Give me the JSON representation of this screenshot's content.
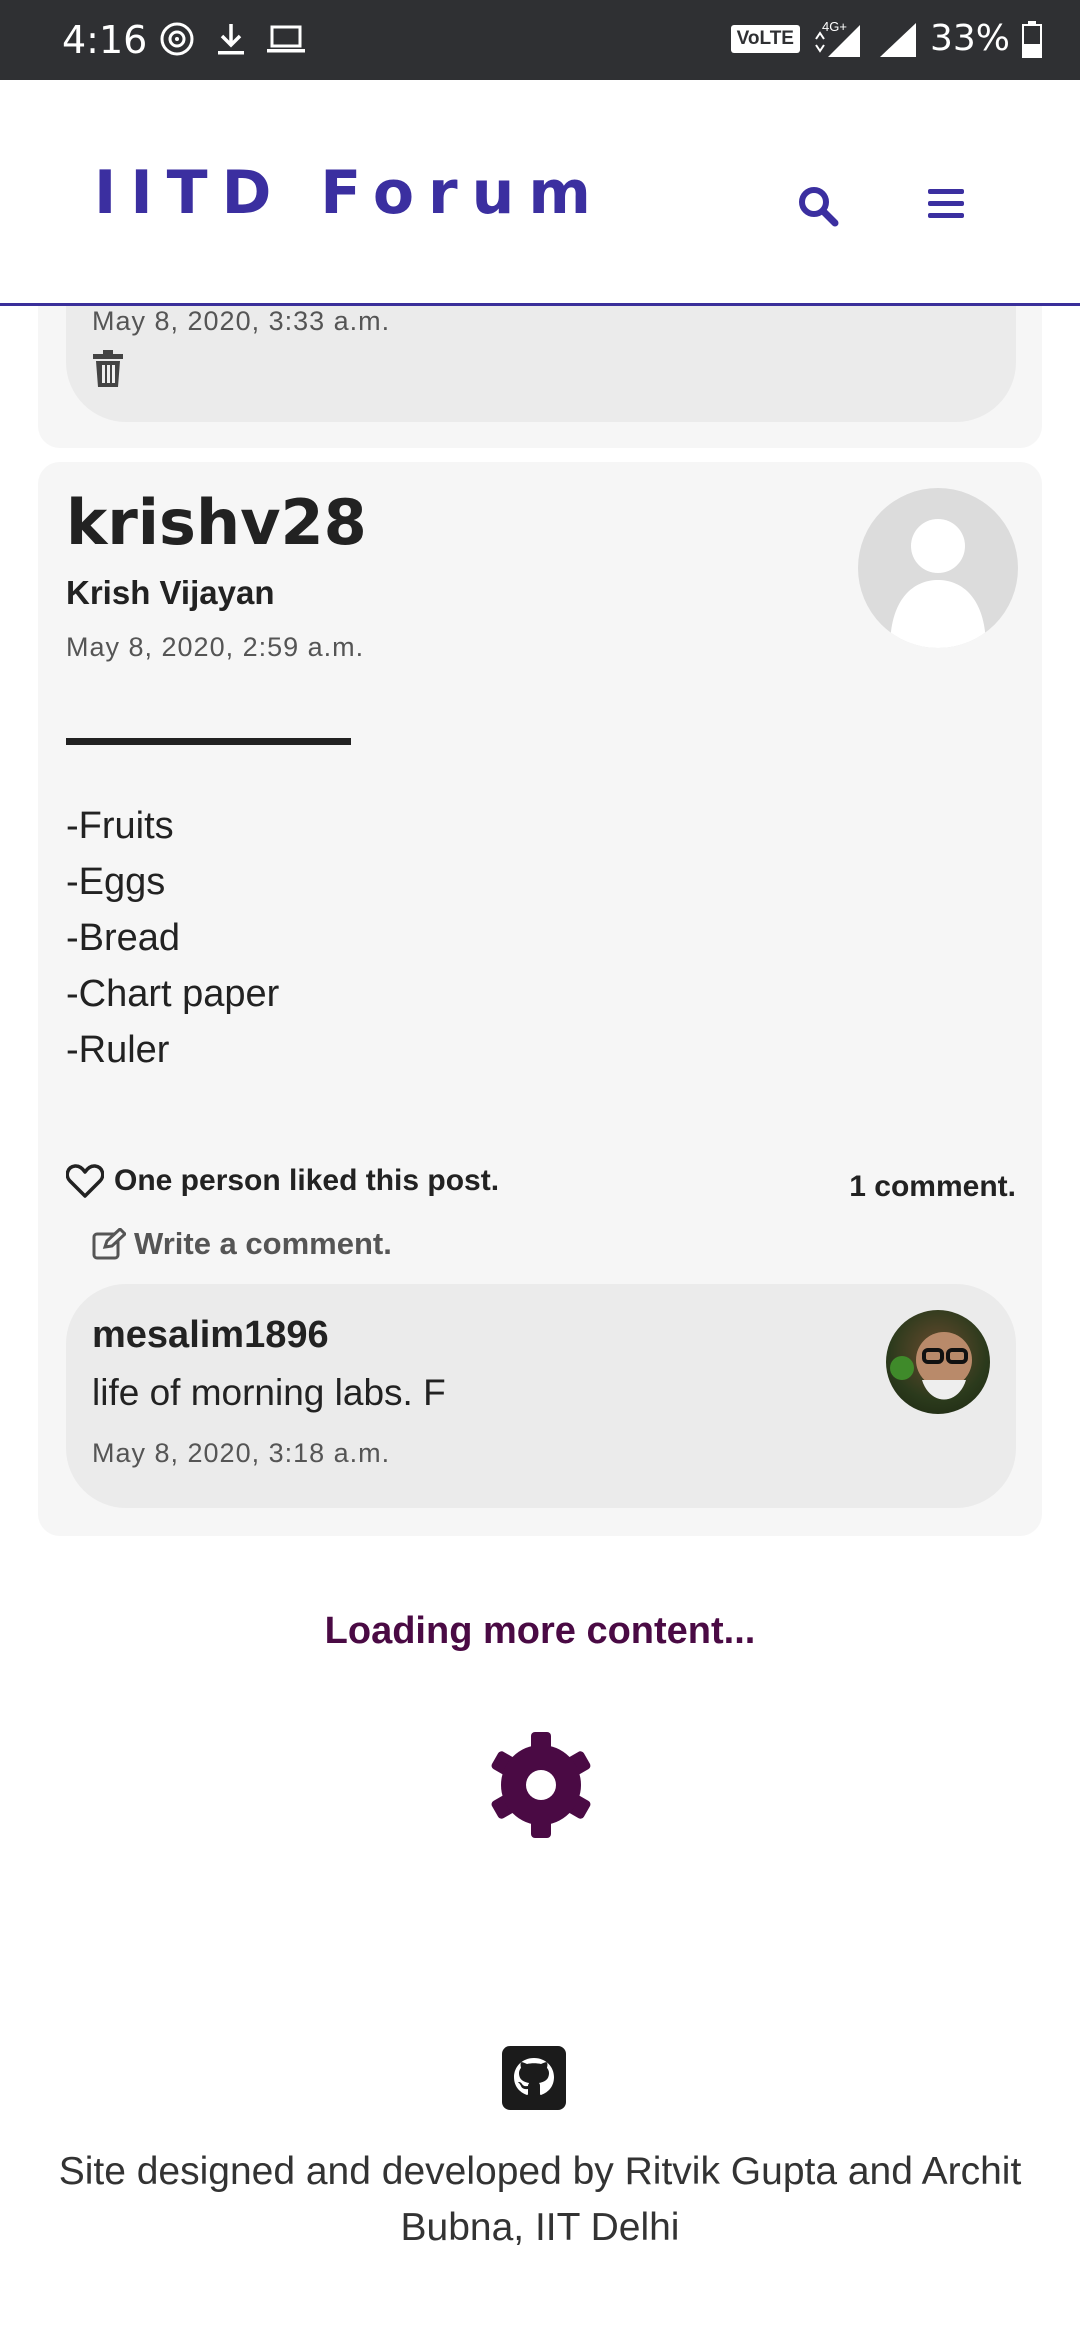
{
  "status_bar": {
    "time": "4:16",
    "network": "VoLTE",
    "signal": "4G+",
    "battery": "33%"
  },
  "navbar": {
    "brand": "IITD Forum",
    "icons": [
      "search-icon",
      "menu-icon"
    ],
    "accent_color": "#3b2fa0"
  },
  "previous_post": {
    "comment_date": "May 8, 2020, 3:33 a.m.",
    "delete_icon": "trash-icon"
  },
  "post": {
    "username": "krishv28",
    "full_name": "Krish Vijayan",
    "date": "May 8, 2020, 2:59 a.m.",
    "items": [
      "-Fruits",
      "-Eggs",
      "-Bread",
      "-Chart paper",
      "-Ruler"
    ],
    "likes_text": "One person liked this post.",
    "comments_count": "1 comment.",
    "write_comment": "Write a comment."
  },
  "comment": {
    "username": "mesalim1896",
    "text": "life of morning labs. F",
    "date": "May 8, 2020, 3:18 a.m."
  },
  "loading": {
    "text": "Loading more content...",
    "color": "#4a0a44"
  },
  "footer": {
    "credit": "Site designed and developed by Ritvik Gupta and Archit Bubna, IIT Delhi"
  }
}
